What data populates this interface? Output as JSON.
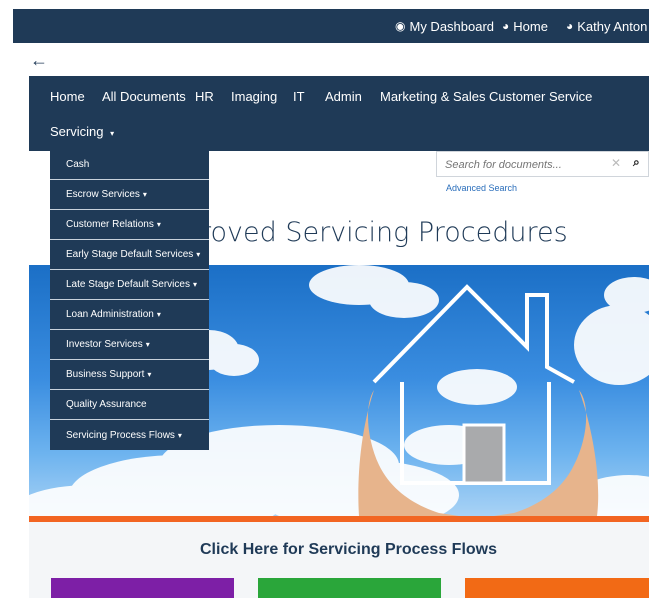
{
  "topbar": {
    "dashboard": {
      "label": "My Dashboard",
      "icon": "dashboard-icon"
    },
    "home": {
      "label": "Home",
      "icon": "globe-icon"
    },
    "user": {
      "label": "Kathy Anton",
      "icon": "globe-icon"
    }
  },
  "nav": {
    "back_icon": "←",
    "items": [
      "Home",
      "All Documents",
      "HR",
      "Imaging",
      "IT",
      "Admin",
      "Marketing & Sales",
      "Customer Service"
    ],
    "servicing": "Servicing"
  },
  "dropdown": {
    "items": [
      {
        "label": "Cash",
        "has_submenu": false
      },
      {
        "label": "Escrow Services",
        "has_submenu": true
      },
      {
        "label": "Customer Relations",
        "has_submenu": true
      },
      {
        "label": "Early Stage Default Services",
        "has_submenu": true
      },
      {
        "label": "Late Stage Default Services",
        "has_submenu": true
      },
      {
        "label": "Loan Administration",
        "has_submenu": true
      },
      {
        "label": "Investor Services",
        "has_submenu": true
      },
      {
        "label": "Business Support",
        "has_submenu": true
      },
      {
        "label": "Quality Assurance",
        "has_submenu": false
      },
      {
        "label": "Servicing Process Flows",
        "has_submenu": true
      }
    ]
  },
  "search": {
    "placeholder": "Search for documents...",
    "clear_icon": "✕",
    "search_icon": "🔍",
    "advanced": "Advanced Search"
  },
  "page": {
    "title": "roved Servicing Procedures",
    "cta": "Click Here for Servicing Process Flows"
  },
  "colors": {
    "navy": "#1f3a57",
    "orange": "#f26522",
    "purple": "#7d1fa6",
    "green": "#2aa63a",
    "tile_orange": "#f26a15"
  }
}
